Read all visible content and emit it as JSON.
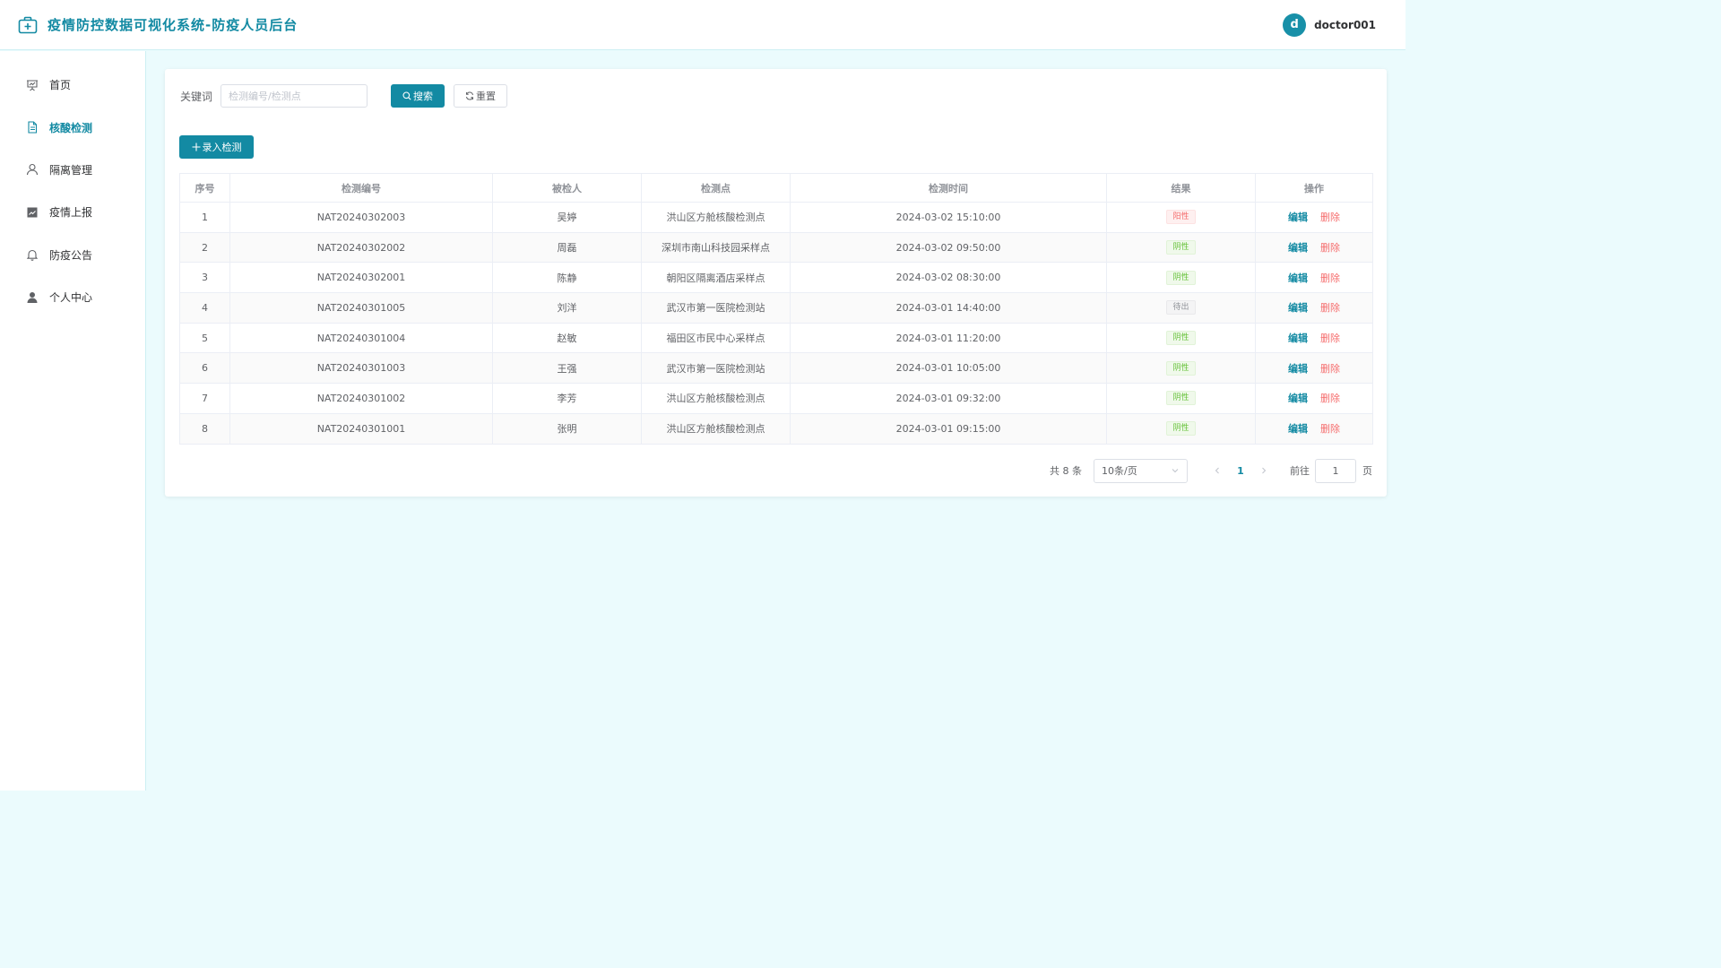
{
  "header": {
    "title": "疫情防控数据可视化系统-防疫人员后台",
    "user_initial": "d",
    "username": "doctor001"
  },
  "sidebar": {
    "items": [
      {
        "label": "首页",
        "icon": "chart-board-icon",
        "active": false
      },
      {
        "label": "核酸检测",
        "icon": "document-icon",
        "active": true
      },
      {
        "label": "隔离管理",
        "icon": "user-icon",
        "active": false
      },
      {
        "label": "疫情上报",
        "icon": "trend-chart-icon",
        "active": false
      },
      {
        "label": "防疫公告",
        "icon": "bell-icon",
        "active": false
      },
      {
        "label": "个人中心",
        "icon": "user-filled-icon",
        "active": false
      }
    ]
  },
  "search": {
    "label": "关键词",
    "placeholder": "检测编号/检测点",
    "value": "",
    "search_label": "搜索",
    "reset_label": "重置"
  },
  "toolbar": {
    "add_label": "录入检测"
  },
  "table": {
    "columns": [
      "序号",
      "检测编号",
      "被检人",
      "检测点",
      "检测时间",
      "结果",
      "操作"
    ],
    "edit_label": "编辑",
    "delete_label": "删除",
    "rows": [
      {
        "index": "1",
        "code": "NAT20240302003",
        "person": "吴婷",
        "site": "洪山区方舱核酸检测点",
        "time": "2024-03-02 15:10:00",
        "result": "阳性",
        "result_type": "positive"
      },
      {
        "index": "2",
        "code": "NAT20240302002",
        "person": "周磊",
        "site": "深圳市南山科技园采样点",
        "time": "2024-03-02 09:50:00",
        "result": "阴性",
        "result_type": "negative"
      },
      {
        "index": "3",
        "code": "NAT20240302001",
        "person": "陈静",
        "site": "朝阳区隔离酒店采样点",
        "time": "2024-03-02 08:30:00",
        "result": "阴性",
        "result_type": "negative"
      },
      {
        "index": "4",
        "code": "NAT20240301005",
        "person": "刘洋",
        "site": "武汉市第一医院检测站",
        "time": "2024-03-01 14:40:00",
        "result": "待出",
        "result_type": "pending"
      },
      {
        "index": "5",
        "code": "NAT20240301004",
        "person": "赵敏",
        "site": "福田区市民中心采样点",
        "time": "2024-03-01 11:20:00",
        "result": "阴性",
        "result_type": "negative"
      },
      {
        "index": "6",
        "code": "NAT20240301003",
        "person": "王强",
        "site": "武汉市第一医院检测站",
        "time": "2024-03-01 10:05:00",
        "result": "阴性",
        "result_type": "negative"
      },
      {
        "index": "7",
        "code": "NAT20240301002",
        "person": "李芳",
        "site": "洪山区方舱核酸检测点",
        "time": "2024-03-01 09:32:00",
        "result": "阴性",
        "result_type": "negative"
      },
      {
        "index": "8",
        "code": "NAT20240301001",
        "person": "张明",
        "site": "洪山区方舱核酸检测点",
        "time": "2024-03-01 09:15:00",
        "result": "阴性",
        "result_type": "negative"
      }
    ]
  },
  "pagination": {
    "total_text": "共 8 条",
    "page_size": "10条/页",
    "current_page": "1",
    "goto_label": "前往",
    "goto_value": "1",
    "goto_suffix": "页"
  },
  "colors": {
    "accent": "#138aa3",
    "background": "#ebfbfd",
    "positive": "#f56c6c",
    "negative": "#67c23a",
    "pending": "#909399"
  }
}
